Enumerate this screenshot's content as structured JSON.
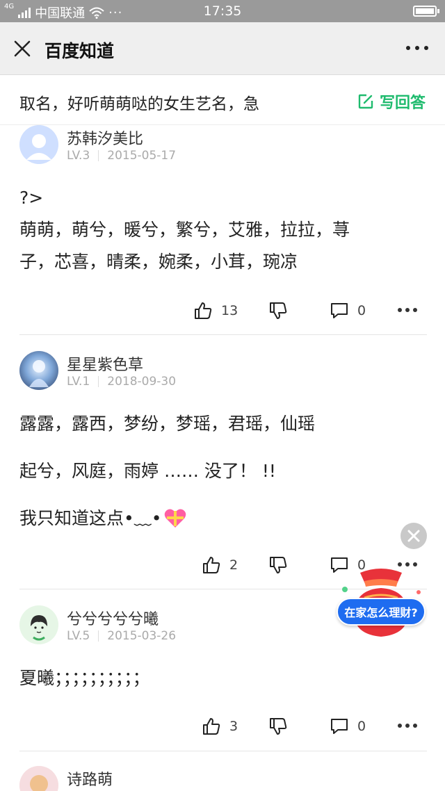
{
  "status_bar": {
    "carrier": "中国联通",
    "time": "17:35",
    "net_label": "4G"
  },
  "nav": {
    "title": "百度知道"
  },
  "question": {
    "text": "取名，好听萌萌哒的女生艺名，急",
    "write_answer_label": "写回答"
  },
  "answers": [
    {
      "username": "苏韩汐美比",
      "level": "LV.3",
      "date": "2015-05-17",
      "lines": [
        "?>",
        "萌萌，萌兮，暖兮，繁兮，艾雅，拉拉，荨",
        "子，芯喜，晴柔，婉柔，小茸，琬凉"
      ],
      "likes": "13",
      "comments": "0"
    },
    {
      "username": "星星紫色草",
      "level": "LV.1",
      "date": "2018-09-30",
      "lines": [
        "露露，露西，梦纷，梦瑶，君瑶，仙瑶",
        "起兮，风庭，雨婷 …… 没了！ !!",
        "我只知道这点•﹏•"
      ],
      "likes": "2",
      "comments": "0"
    },
    {
      "username": "兮兮兮兮兮曦",
      "level": "LV.5",
      "date": "2015-03-26",
      "lines": [
        "夏曦；；；；；；；；；；"
      ],
      "likes": "3",
      "comments": "0"
    },
    {
      "username": "诗路萌"
    }
  ],
  "promo": {
    "label": "在家怎么理财?"
  },
  "icons": {
    "close": "close-icon",
    "more": "more-icon",
    "edit": "edit-icon",
    "like": "thumbs-up-icon",
    "dislike": "thumbs-down-icon",
    "comment": "comment-icon"
  }
}
